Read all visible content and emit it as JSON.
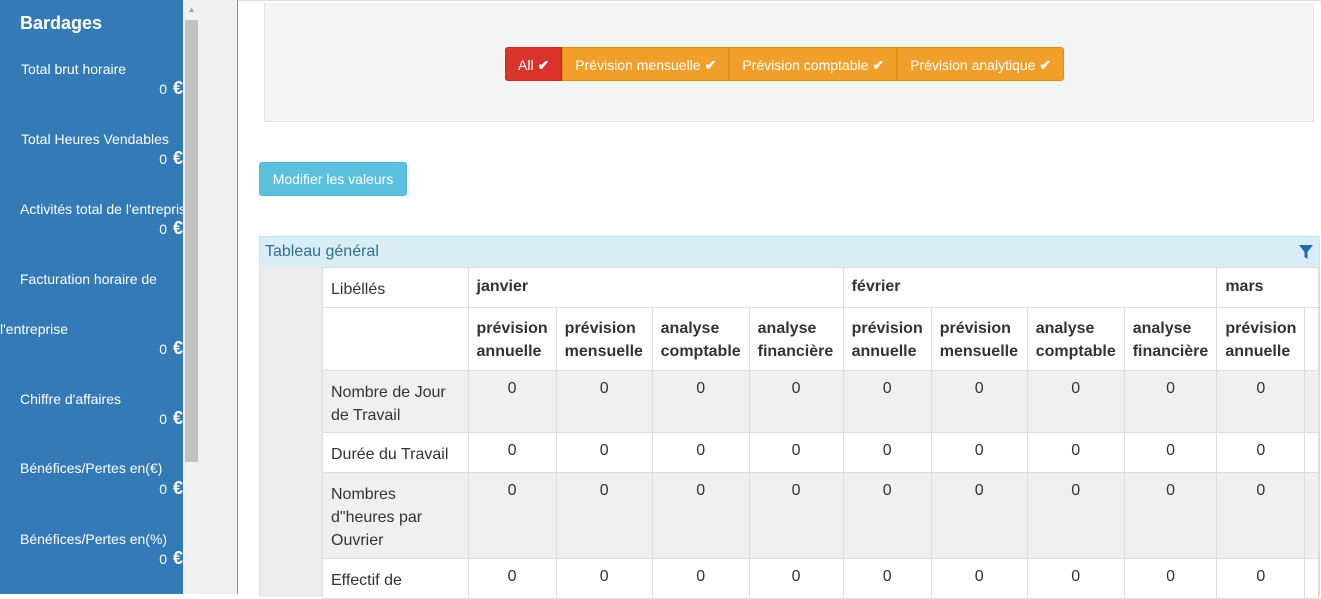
{
  "sidebar": {
    "title": "Bardages",
    "currency": "€",
    "items": [
      {
        "label": "Total brut horaire",
        "value": "0"
      },
      {
        "label": "Total Heures Vendables",
        "value": "0"
      },
      {
        "label": "Activités total de l'entreprise",
        "value": "0"
      },
      {
        "label_line1": "Facturation horaire de",
        "label_line2": "l'entreprise",
        "value": "0"
      },
      {
        "label": "Chiffre d'affaires",
        "value": "0"
      },
      {
        "label": "Bénéfices/Pertes en(€)",
        "value": "0"
      },
      {
        "label": "Bénéfices/Pertes en(%)",
        "value": "0"
      }
    ]
  },
  "filters": [
    {
      "label": "All",
      "active": true
    },
    {
      "label": "Prévision mensuelle",
      "active": false
    },
    {
      "label": "Prévision comptable",
      "active": false
    },
    {
      "label": "Prévision analytique",
      "active": false
    }
  ],
  "check_glyph": "✔",
  "modify_button": "Modifier les valeurs",
  "panel": {
    "title": "Tableau général",
    "filter_icon": "funnel-icon"
  },
  "table": {
    "label_header": "Libéllés",
    "months": [
      "janvier",
      "février",
      "mars"
    ],
    "sub_headers": [
      [
        "prévision",
        "annuelle"
      ],
      [
        "prévision",
        "mensuelle"
      ],
      [
        "analyse",
        "comptable"
      ],
      [
        "analyse",
        "financière"
      ]
    ],
    "rows": [
      {
        "label": [
          "Nombre de Jour",
          "de Travail"
        ],
        "values": [
          "0",
          "0",
          "0",
          "0",
          "0",
          "0",
          "0",
          "0",
          "0"
        ]
      },
      {
        "label": [
          "Durée du Travail"
        ],
        "values": [
          "0",
          "0",
          "0",
          "0",
          "0",
          "0",
          "0",
          "0",
          "0"
        ]
      },
      {
        "label": [
          "Nombres",
          "d\"heures par",
          "Ouvrier"
        ],
        "values": [
          "0",
          "0",
          "0",
          "0",
          "0",
          "0",
          "0",
          "0",
          "0"
        ]
      },
      {
        "label": [
          "Effectif de"
        ],
        "values": [
          "0",
          "0",
          "0",
          "0",
          "0",
          "0",
          "0",
          "0",
          "0"
        ]
      }
    ]
  },
  "colors": {
    "sidebar": "#337ab7",
    "active_filter": "#d9342b",
    "filter": "#f0a02a",
    "info_button": "#5bc0de",
    "panel_heading": "#d9edf7"
  }
}
